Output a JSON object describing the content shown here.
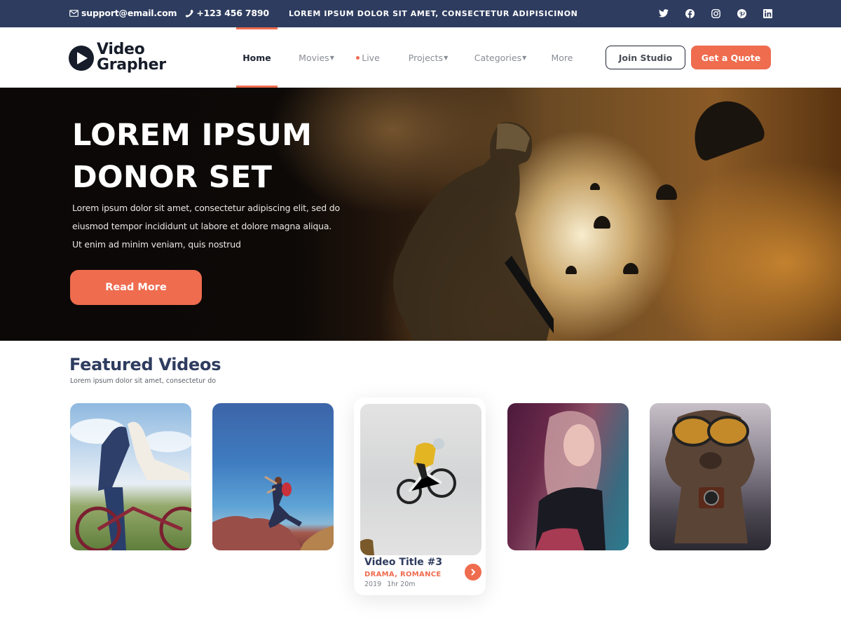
{
  "topbar": {
    "email": "support@email.com",
    "phone": "+123 456 7890",
    "tagline": "LOREM IPSUM DOLOR SIT AMET, CONSECTETUR ADIPISICINON",
    "socials": [
      "twitter",
      "facebook",
      "instagram",
      "pinterest",
      "linkedin"
    ]
  },
  "brand": {
    "line1": "Video",
    "line2": "Grapher"
  },
  "nav": {
    "items": [
      {
        "label": "Home",
        "active": true
      },
      {
        "label": "Movies",
        "dropdown": true
      },
      {
        "label": "Live",
        "live": true
      },
      {
        "label": "Projects",
        "dropdown": true
      },
      {
        "label": "Categories",
        "dropdown": true
      },
      {
        "label": "More"
      }
    ],
    "join_label": "Join Studio",
    "quote_label": "Get a Quote"
  },
  "hero": {
    "title_line1": "LOREM IPSUM",
    "title_line2": "DONOR SET",
    "body_line1": "Lorem ipsum dolor sit amet, consectetur adipiscing elit, sed do",
    "body_line2": "eiusmod tempor incididunt ut labore et dolore magna aliqua.",
    "body_line3": "Ut enim ad minim veniam, quis nostrud",
    "cta_label": "Read More"
  },
  "featured": {
    "title": "Featured Videos",
    "subtitle": "Lorem ipsum dolor sit amet, consectetur  do",
    "cards": [
      {
        "image": "couple-on-bicycle"
      },
      {
        "image": "man-jumping-rocks"
      },
      {
        "image": "bmx-rider-jump",
        "title": "Video Title #3",
        "genre": "DRAMA, ROMANCE",
        "year": "2019",
        "duration": "1hr 20m"
      },
      {
        "image": "woman-neon-portrait"
      },
      {
        "image": "dog-with-sunglasses-camera"
      }
    ]
  },
  "colors": {
    "accent": "#ef6c4f",
    "navy": "#2e3c5f",
    "dark": "#161c29"
  }
}
